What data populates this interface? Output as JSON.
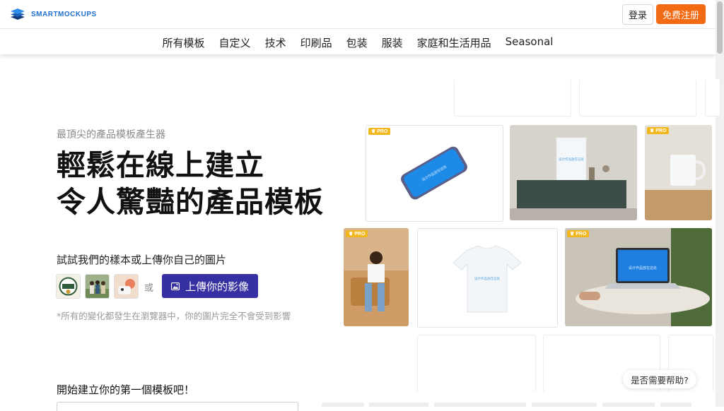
{
  "header": {
    "logo_text": "SMARTMOCKUPS",
    "login_label": "登录",
    "signup_label": "免费注册"
  },
  "nav": {
    "items": [
      "所有模板",
      "自定义",
      "技术",
      "印刷品",
      "包装",
      "服装",
      "家庭和生活用品",
      "Seasonal"
    ]
  },
  "hero": {
    "eyebrow": "最頂尖的產品模板產生器",
    "headline_line1": "輕鬆在線上建立",
    "headline_line2": "令人驚豔的產品模板",
    "try_text": "試試我們的樣本或上傳你自己的圖片",
    "or_text": "或",
    "upload_label": "上傳你的影像",
    "note": "*所有的變化都發生在瀏覽器中，你的圖片完全不會受到影響",
    "start_text": "開始建立你的第一個模板吧！"
  },
  "gallery": {
    "pro_badge": "PRO",
    "mock_text": "设计作品放在这处"
  },
  "help_label": "是否需要帮助?",
  "colors": {
    "brand_blue": "#1f6fd0",
    "signup_orange": "#f26a14",
    "upload_indigo": "#3730a3",
    "pro_yellow": "#f2b71d"
  },
  "icons": {
    "logo": "layered-stack-icon",
    "upload": "image-upload-icon",
    "pro": "crown-icon"
  }
}
